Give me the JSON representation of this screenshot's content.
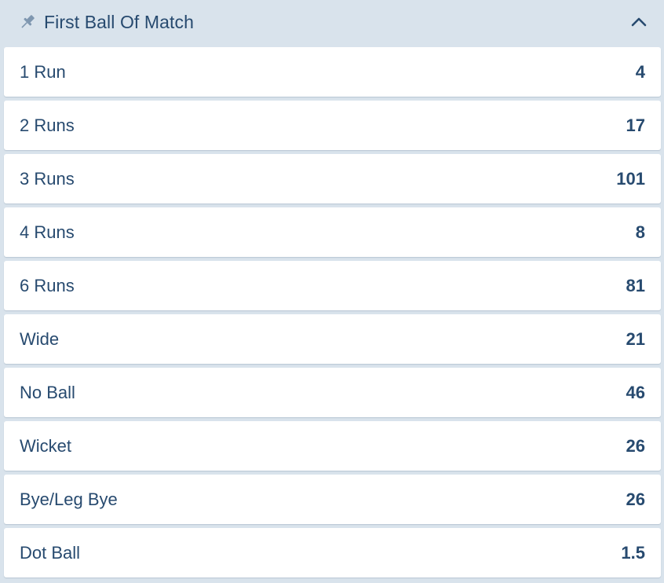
{
  "market": {
    "title": "First Ball Of Match",
    "pin_icon": "pin-icon",
    "collapse_icon": "chevron-up-icon",
    "expanded": true
  },
  "selections": [
    {
      "label": "1 Run",
      "odds": "4"
    },
    {
      "label": "2 Runs",
      "odds": "17"
    },
    {
      "label": "3 Runs",
      "odds": "101"
    },
    {
      "label": "4 Runs",
      "odds": "8"
    },
    {
      "label": "6 Runs",
      "odds": "81"
    },
    {
      "label": "Wide",
      "odds": "21"
    },
    {
      "label": "No Ball",
      "odds": "46"
    },
    {
      "label": "Wicket",
      "odds": "26"
    },
    {
      "label": "Bye/Leg Bye",
      "odds": "26"
    },
    {
      "label": "Dot Ball",
      "odds": "1.5"
    }
  ],
  "colors": {
    "background": "#d9e3ec",
    "row_background": "#ffffff",
    "text": "#274a6f",
    "icon": "#7f97b0"
  }
}
